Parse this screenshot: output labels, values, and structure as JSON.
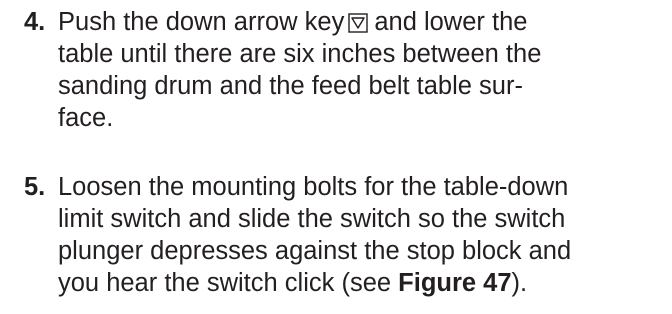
{
  "steps": [
    {
      "number": "4.",
      "lines": [
        {
          "before": "Push the down arrow key",
          "icon": "down-arrow-key-icon",
          "after": "and lower the"
        },
        "table until there are six inches between the",
        "sanding drum and the feed belt table sur-",
        "face."
      ]
    },
    {
      "number": "5.",
      "lines": [
        "Loosen the mounting bolts for the table-down",
        "limit switch and slide the switch so the switch",
        "plunger depresses against the stop block and",
        {
          "before": "you hear the switch click (see ",
          "bold": "Figure 47",
          "after": ")."
        }
      ]
    }
  ],
  "colors": {
    "text": "#231f20"
  }
}
